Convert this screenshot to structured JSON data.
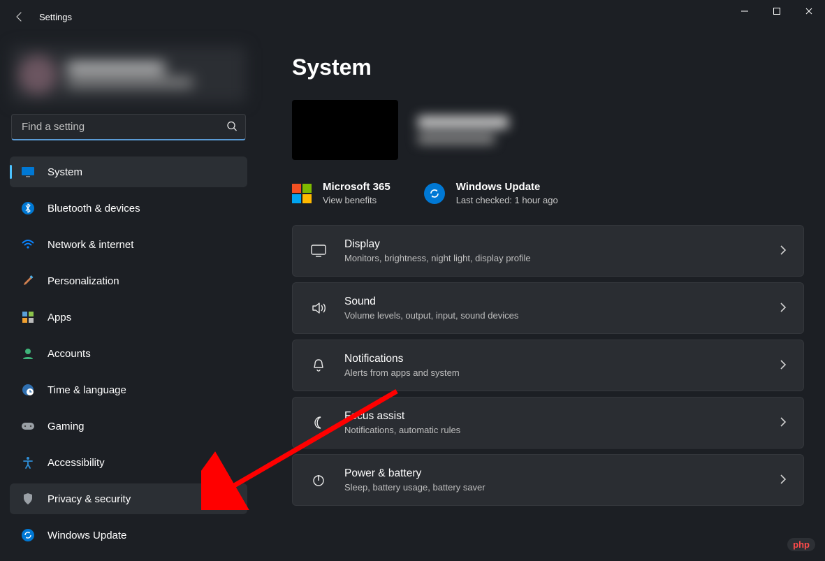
{
  "app": {
    "title": "Settings"
  },
  "search": {
    "placeholder": "Find a setting"
  },
  "sidebar": {
    "items": [
      {
        "label": "System"
      },
      {
        "label": "Bluetooth & devices"
      },
      {
        "label": "Network & internet"
      },
      {
        "label": "Personalization"
      },
      {
        "label": "Apps"
      },
      {
        "label": "Accounts"
      },
      {
        "label": "Time & language"
      },
      {
        "label": "Gaming"
      },
      {
        "label": "Accessibility"
      },
      {
        "label": "Privacy & security"
      },
      {
        "label": "Windows Update"
      }
    ]
  },
  "main": {
    "title": "System",
    "promos": {
      "ms365": {
        "title": "Microsoft 365",
        "sub": "View benefits"
      },
      "wu": {
        "title": "Windows Update",
        "sub": "Last checked: 1 hour ago"
      }
    },
    "rows": [
      {
        "title": "Display",
        "sub": "Monitors, brightness, night light, display profile"
      },
      {
        "title": "Sound",
        "sub": "Volume levels, output, input, sound devices"
      },
      {
        "title": "Notifications",
        "sub": "Alerts from apps and system"
      },
      {
        "title": "Focus assist",
        "sub": "Notifications, automatic rules"
      },
      {
        "title": "Power & battery",
        "sub": "Sleep, battery usage, battery saver"
      }
    ]
  },
  "badge": "php"
}
